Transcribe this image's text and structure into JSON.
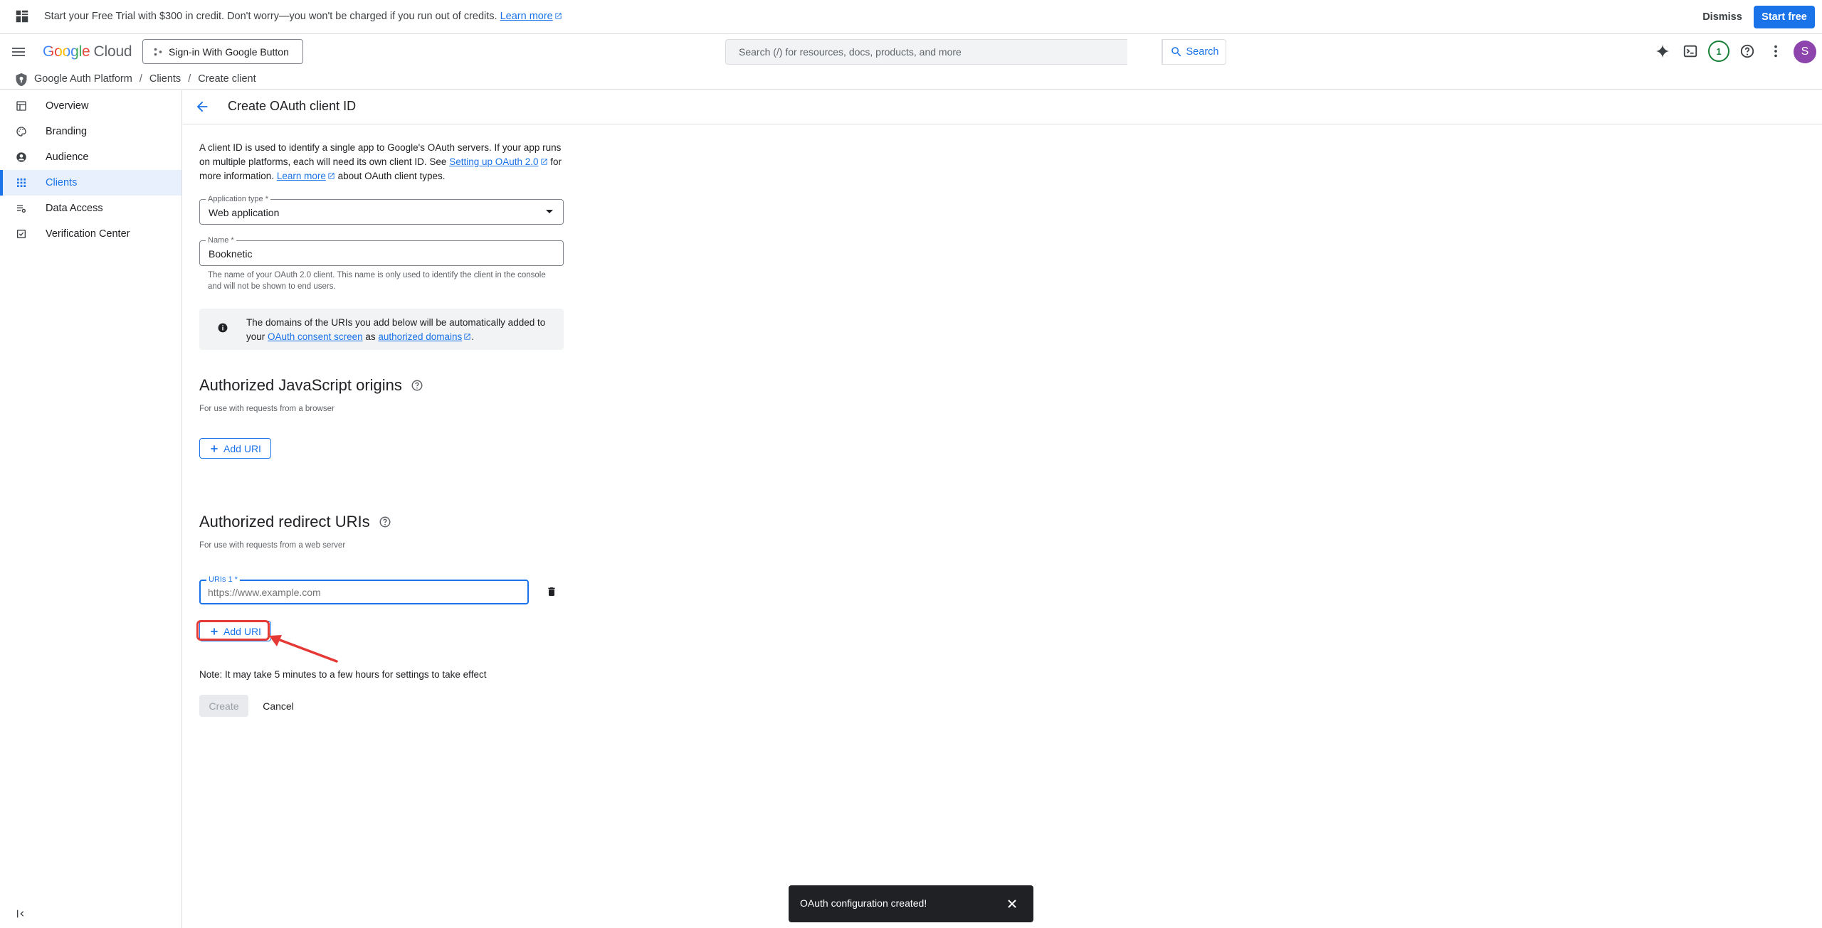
{
  "banner": {
    "message": "Start your Free Trial with $300 in credit. Don't worry—you won't be charged if you run out of credits.",
    "learn_more": "Learn more",
    "dismiss": "Dismiss",
    "start_free": "Start free"
  },
  "topbar": {
    "logo_google": "Google",
    "logo_cloud": "Cloud",
    "project": "Sign-in With Google Button",
    "search_placeholder": "Search (/) for resources, docs, products, and more",
    "search_button": "Search",
    "notifications_count": "1",
    "avatar_letter": "S"
  },
  "breadcrumb": {
    "items": [
      "Google Auth Platform",
      "Clients",
      "Create client"
    ],
    "separator": "/"
  },
  "sidebar": {
    "items": [
      {
        "label": "Overview",
        "icon": "dashboard-icon"
      },
      {
        "label": "Branding",
        "icon": "palette-icon"
      },
      {
        "label": "Audience",
        "icon": "account-circle-icon"
      },
      {
        "label": "Clients",
        "icon": "apps-grid-icon",
        "active": true
      },
      {
        "label": "Data Access",
        "icon": "tune-list-icon"
      },
      {
        "label": "Verification Center",
        "icon": "checklist-icon"
      }
    ]
  },
  "page": {
    "title": "Create OAuth client ID",
    "intro_1": "A client ID is used to identify a single app to Google's OAuth servers. If your app runs on multiple platforms, each will need its own client ID. See",
    "intro_link_1": "Setting up OAuth 2.0",
    "intro_2": "for more information.",
    "intro_link_2": "Learn more",
    "intro_3": "about OAuth client types.",
    "app_type_label": "Application type *",
    "app_type_value": "Web application",
    "name_label": "Name *",
    "name_value": "Booknetic",
    "name_hint": "The name of your OAuth 2.0 client. This name is only used to identify the client in the console and will not be shown to end users.",
    "info_1": "The domains of the URIs you add below will be automatically added to your",
    "info_link_1": "OAuth consent screen",
    "info_2": "as",
    "info_link_2": "authorized domains",
    "info_3": ".",
    "js_origins_title": "Authorized JavaScript origins",
    "js_origins_sub": "For use with requests from a browser",
    "add_uri": "Add URI",
    "redirect_title": "Authorized redirect URIs",
    "redirect_sub": "For use with requests from a web server",
    "uri_label": "URIs 1 *",
    "uri_placeholder": "https://www.example.com",
    "note": "Note: It may take 5 minutes to a few hours for settings to take effect",
    "create": "Create",
    "cancel": "Cancel"
  },
  "toast": {
    "message": "OAuth configuration created!"
  },
  "colors": {
    "accent": "#1a73e8",
    "highlight": "#e53935",
    "active_nav_bg": "#e8f0fe"
  }
}
